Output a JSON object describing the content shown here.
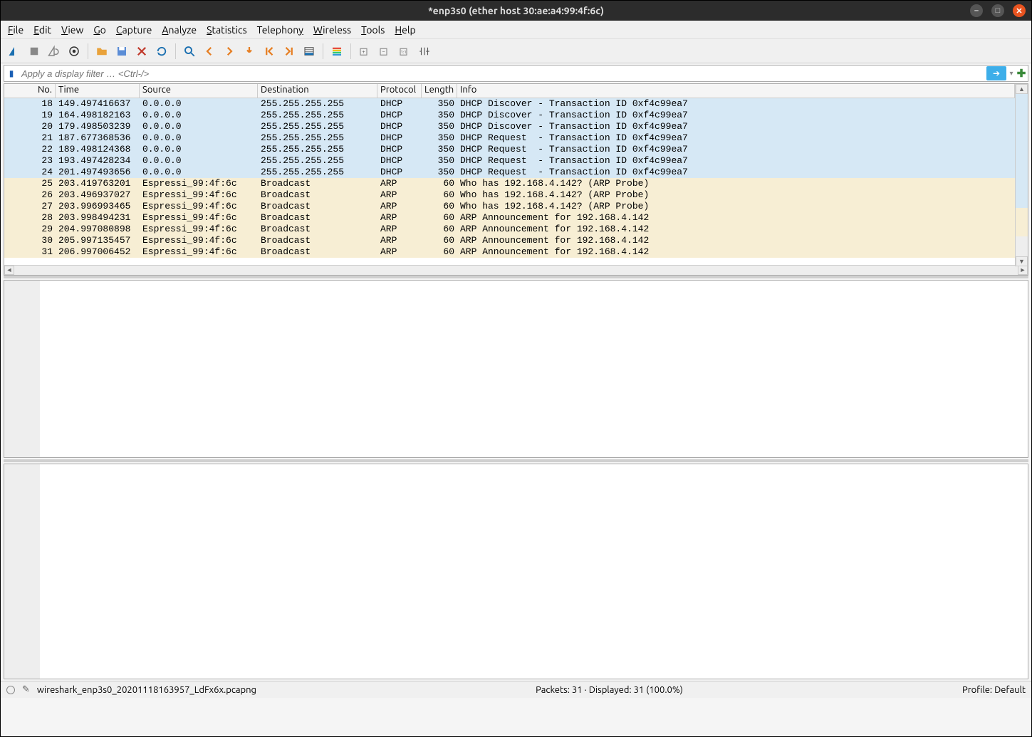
{
  "window": {
    "title": "*enp3s0 (ether host 30:ae:a4:99:4f:6c)"
  },
  "menu": {
    "file": "File",
    "edit": "Edit",
    "view": "View",
    "go": "Go",
    "capture": "Capture",
    "analyze": "Analyze",
    "statistics": "Statistics",
    "telephony": "Telephony",
    "wireless": "Wireless",
    "tools": "Tools",
    "help": "Help"
  },
  "filter": {
    "placeholder": "Apply a display filter … <Ctrl-/>"
  },
  "columns": {
    "no": "No.",
    "time": "Time",
    "source": "Source",
    "destination": "Destination",
    "protocol": "Protocol",
    "length": "Length",
    "info": "Info"
  },
  "packets": [
    {
      "no": "18",
      "time": "149.497416637",
      "src": "0.0.0.0",
      "dst": "255.255.255.255",
      "proto": "DHCP",
      "len": "350",
      "info": "DHCP Discover - Transaction ID 0xf4c99ea7",
      "cls": "dhcp"
    },
    {
      "no": "19",
      "time": "164.498182163",
      "src": "0.0.0.0",
      "dst": "255.255.255.255",
      "proto": "DHCP",
      "len": "350",
      "info": "DHCP Discover - Transaction ID 0xf4c99ea7",
      "cls": "dhcp"
    },
    {
      "no": "20",
      "time": "179.498503239",
      "src": "0.0.0.0",
      "dst": "255.255.255.255",
      "proto": "DHCP",
      "len": "350",
      "info": "DHCP Discover - Transaction ID 0xf4c99ea7",
      "cls": "dhcp"
    },
    {
      "no": "21",
      "time": "187.677368536",
      "src": "0.0.0.0",
      "dst": "255.255.255.255",
      "proto": "DHCP",
      "len": "350",
      "info": "DHCP Request  - Transaction ID 0xf4c99ea7",
      "cls": "dhcp"
    },
    {
      "no": "22",
      "time": "189.498124368",
      "src": "0.0.0.0",
      "dst": "255.255.255.255",
      "proto": "DHCP",
      "len": "350",
      "info": "DHCP Request  - Transaction ID 0xf4c99ea7",
      "cls": "dhcp"
    },
    {
      "no": "23",
      "time": "193.497428234",
      "src": "0.0.0.0",
      "dst": "255.255.255.255",
      "proto": "DHCP",
      "len": "350",
      "info": "DHCP Request  - Transaction ID 0xf4c99ea7",
      "cls": "dhcp"
    },
    {
      "no": "24",
      "time": "201.497493656",
      "src": "0.0.0.0",
      "dst": "255.255.255.255",
      "proto": "DHCP",
      "len": "350",
      "info": "DHCP Request  - Transaction ID 0xf4c99ea7",
      "cls": "dhcp"
    },
    {
      "no": "25",
      "time": "203.419763201",
      "src": "Espressi_99:4f:6c",
      "dst": "Broadcast",
      "proto": "ARP",
      "len": "60",
      "info": "Who has 192.168.4.142? (ARP Probe)",
      "cls": "arp"
    },
    {
      "no": "26",
      "time": "203.496937027",
      "src": "Espressi_99:4f:6c",
      "dst": "Broadcast",
      "proto": "ARP",
      "len": "60",
      "info": "Who has 192.168.4.142? (ARP Probe)",
      "cls": "arp"
    },
    {
      "no": "27",
      "time": "203.996993465",
      "src": "Espressi_99:4f:6c",
      "dst": "Broadcast",
      "proto": "ARP",
      "len": "60",
      "info": "Who has 192.168.4.142? (ARP Probe)",
      "cls": "arp"
    },
    {
      "no": "28",
      "time": "203.998494231",
      "src": "Espressi_99:4f:6c",
      "dst": "Broadcast",
      "proto": "ARP",
      "len": "60",
      "info": "ARP Announcement for 192.168.4.142",
      "cls": "arp"
    },
    {
      "no": "29",
      "time": "204.997080898",
      "src": "Espressi_99:4f:6c",
      "dst": "Broadcast",
      "proto": "ARP",
      "len": "60",
      "info": "ARP Announcement for 192.168.4.142",
      "cls": "arp"
    },
    {
      "no": "30",
      "time": "205.997135457",
      "src": "Espressi_99:4f:6c",
      "dst": "Broadcast",
      "proto": "ARP",
      "len": "60",
      "info": "ARP Announcement for 192.168.4.142",
      "cls": "arp"
    },
    {
      "no": "31",
      "time": "206.997006452",
      "src": "Espressi_99:4f:6c",
      "dst": "Broadcast",
      "proto": "ARP",
      "len": "60",
      "info": "ARP Announcement for 192.168.4.142",
      "cls": "arp"
    }
  ],
  "status": {
    "file": "wireshark_enp3s0_20201118163957_LdFx6x.pcapng",
    "packets": "Packets: 31 · Displayed: 31 (100.0%)",
    "profile": "Profile: Default"
  }
}
